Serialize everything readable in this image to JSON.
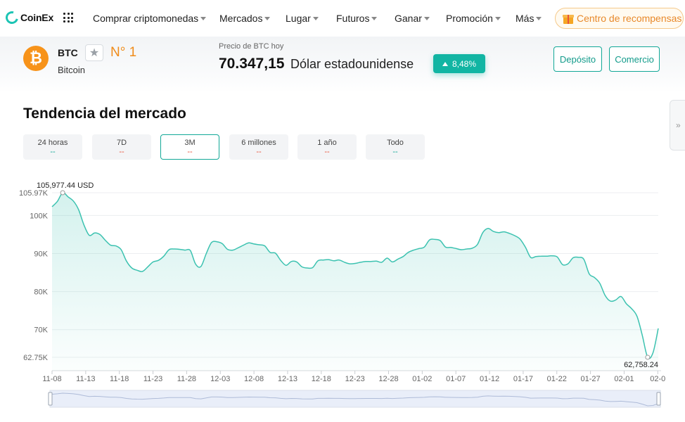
{
  "nav": {
    "logo": "CoinEx",
    "items": [
      {
        "label": "Comprar criptomonedas",
        "caret": true
      },
      {
        "label": "Mercados",
        "caret": true
      },
      {
        "label": "Lugar",
        "caret": true
      },
      {
        "label": "Futuros",
        "caret": true
      },
      {
        "label": "Ganar",
        "caret": true
      },
      {
        "label": "Promoción",
        "caret": true
      },
      {
        "label": "Más",
        "caret": true
      }
    ],
    "rewards": "Centro de recompensas"
  },
  "coin": {
    "symbol": "BTC",
    "name": "Bitcoin",
    "rank": "N° 1",
    "logo_glyph": "₿",
    "price_label": "Precio de BTC hoy",
    "price": "70.347,15",
    "price_unit": "Dólar estadounidense",
    "change": "8,48%",
    "deposit_label": "Depósito",
    "trade_label": "Comercio"
  },
  "side_tab_glyph": "»",
  "section": {
    "title": "Tendencia del mercado",
    "tabs": [
      {
        "label": "24 horas",
        "value": "--",
        "color": "#12a897",
        "active": false
      },
      {
        "label": "7D",
        "value": "--",
        "color": "#e8523a",
        "active": false
      },
      {
        "label": "3M",
        "value": "--",
        "color": "#e8523a",
        "active": true
      },
      {
        "label": "6 millones",
        "value": "--",
        "color": "#e8523a",
        "active": false
      },
      {
        "label": "1 año",
        "value": "--",
        "color": "#e8523a",
        "active": false
      },
      {
        "label": "Todo",
        "value": "--",
        "color": "#12a897",
        "active": false
      }
    ]
  },
  "colors": {
    "accent": "#12a897",
    "line": "#3cc2b0",
    "orange": "#f08c1a",
    "down": "#e8523a"
  },
  "chart_data": {
    "type": "area",
    "ylim": [
      62750,
      105970
    ],
    "y_ticks": [
      {
        "value": 105970,
        "label": "105.97K"
      },
      {
        "value": 100000,
        "label": "100K"
      },
      {
        "value": 90000,
        "label": "90K"
      },
      {
        "value": 80000,
        "label": "80K"
      },
      {
        "value": 70000,
        "label": "70K"
      },
      {
        "value": 62750,
        "label": "62.75K"
      }
    ],
    "x_ticks": [
      "11-08",
      "11-13",
      "11-18",
      "11-23",
      "11-28",
      "12-03",
      "12-08",
      "12-13",
      "12-18",
      "12-23",
      "12-28",
      "01-02",
      "01-07",
      "01-12",
      "01-17",
      "01-22",
      "01-27",
      "02-01",
      "02-0"
    ],
    "max_label": "105,977.44 USD",
    "min_label": "62,758.24",
    "values": [
      102300,
      103700,
      105970,
      104900,
      103800,
      101500,
      97500,
      94800,
      95400,
      95000,
      93500,
      92200,
      92000,
      91000,
      88000,
      86200,
      85600,
      85300,
      86500,
      87800,
      88200,
      89300,
      91000,
      91200,
      91100,
      90900,
      90800,
      87200,
      86600,
      90000,
      92900,
      93100,
      92600,
      91100,
      90900,
      91500,
      92200,
      92800,
      92500,
      92300,
      92000,
      90300,
      90100,
      88200,
      86900,
      87900,
      87800,
      86500,
      86200,
      86300,
      88100,
      88300,
      88400,
      88100,
      88300,
      87700,
      87300,
      87400,
      87700,
      87900,
      87900,
      88000,
      87700,
      88800,
      87800,
      88500,
      89200,
      90300,
      90900,
      91300,
      91700,
      93600,
      93700,
      93400,
      91700,
      91600,
      91300,
      91000,
      91200,
      91400,
      92400,
      95500,
      96600,
      95800,
      95500,
      95700,
      95300,
      94700,
      93800,
      91700,
      89000,
      89200,
      89300,
      89300,
      89400,
      89100,
      87100,
      87300,
      88900,
      89000,
      88500,
      84700,
      83700,
      82200,
      79000,
      77500,
      77800,
      78700,
      76800,
      75500,
      73500,
      68500,
      62760,
      63900,
      70350
    ]
  }
}
